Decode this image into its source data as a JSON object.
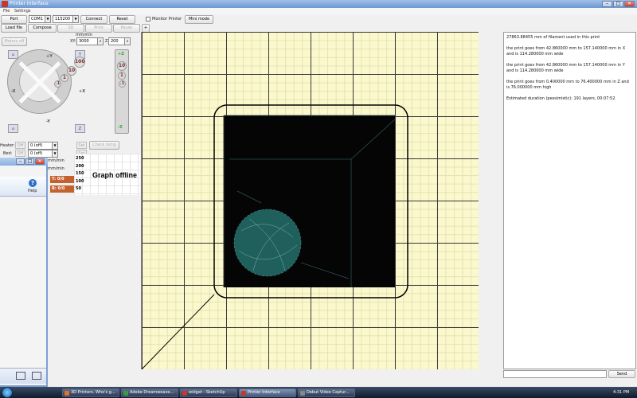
{
  "window": {
    "title": "Printer Interface"
  },
  "menu": [
    "File",
    "Settings"
  ],
  "toolbar1": {
    "port_label": "Port",
    "port_value": "COM1",
    "baud_value": "115200",
    "connect_label": "Connect",
    "reset_label": "Reset",
    "monitor_label": "Monitor Printer",
    "minimode_label": "Mini mode"
  },
  "toolbar2": {
    "loadfile_label": "Load file",
    "compose_label": "Compose",
    "sd_label": "SD",
    "print_label": "Print",
    "pause_label": "Pause",
    "plus_label": "+"
  },
  "motion": {
    "motors_off_label": "Motors off",
    "speed_unit": "mm/min",
    "xy_label": "XY:",
    "xy_value": "3000",
    "z_label": "Z:",
    "z_value": "200"
  },
  "jog": {
    "y_plus": "+Y",
    "y_minus": "-Y",
    "x_plus": "+X",
    "x_minus": "-X",
    "y_home": "Y",
    "z_home": "Z",
    "steps": [
      "100",
      "10",
      "1",
      ".1"
    ],
    "z_plus": "+Z",
    "z_minus": "-Z",
    "z_steps": [
      "10",
      "1",
      ".1"
    ]
  },
  "heaters": {
    "heater_label": "Heater:",
    "bed_label": "Bed:",
    "off_label": "Off",
    "heater_value": "0 (off)",
    "bed_value": "0 (off)",
    "set_label": "Set",
    "check_temp_label": "Check temp",
    "mm_min_1": "mm/min",
    "mm_min_2": "mm/min"
  },
  "graph": {
    "offline_text": "Graph offline",
    "y_labels": [
      "250",
      "200",
      "150",
      "100",
      "50"
    ]
  },
  "help_window": {
    "help_label": "Help",
    "temp1": "T: 0/0",
    "temp2": "B: 0/0"
  },
  "log": [
    "27863.88455 mm of filament used in this print",
    "the print goes from 42.860000 mm to 157.140000 mm in X and is 114.280000 mm wide",
    "the print goes from 42.860000 mm to 157.140000 mm in Y and is 114.280000 mm wide",
    "the print goes from 0.400000 mm to 76.400000 mm in Z and is 76.000000 mm high",
    "Estimated duration (pessimistic): 191 layers, 00:07:52"
  ],
  "send_label": "Send",
  "taskbar": {
    "tasks": [
      "3D Printers. Who's g...",
      "Adobe Dreamweave...",
      "widget - SketchUp",
      "Printer Interface",
      "Debut Video Captur..."
    ],
    "clock": "4:31 PM"
  },
  "colors": {
    "canvas_bg": "#fbf8cd",
    "print_fill": "#050505",
    "sphere": "#1f5f5c",
    "accent_orange": "#c4612f"
  }
}
